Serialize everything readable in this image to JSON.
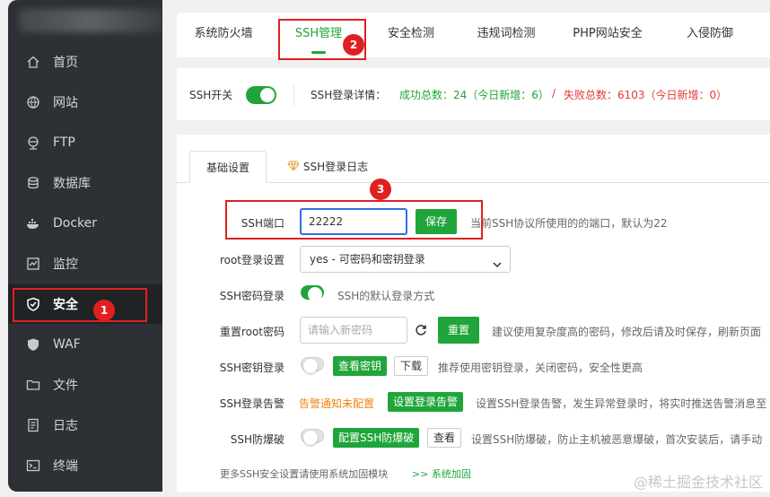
{
  "sidebar": {
    "items": [
      {
        "label": "首页",
        "icon": "home-icon"
      },
      {
        "label": "网站",
        "icon": "globe-icon"
      },
      {
        "label": "FTP",
        "icon": "ftp-icon"
      },
      {
        "label": "数据库",
        "icon": "database-icon"
      },
      {
        "label": "Docker",
        "icon": "docker-icon"
      },
      {
        "label": "监控",
        "icon": "monitor-icon"
      },
      {
        "label": "安全",
        "icon": "shield-check-icon",
        "active": true
      },
      {
        "label": "WAF",
        "icon": "waf-shield-icon"
      },
      {
        "label": "文件",
        "icon": "folder-icon"
      },
      {
        "label": "日志",
        "icon": "log-icon"
      },
      {
        "label": "终端",
        "icon": "terminal-icon"
      }
    ]
  },
  "tabs": [
    {
      "label": "系统防火墙"
    },
    {
      "label": "SSH管理",
      "active": true
    },
    {
      "label": "安全检测"
    },
    {
      "label": "违规词检测"
    },
    {
      "label": "PHP网站安全"
    },
    {
      "label": "入侵防御"
    }
  ],
  "status": {
    "ssh_switch_label": "SSH开关",
    "ssh_switch_on": true,
    "login_detail_label": "SSH登录详情：",
    "success_text": "成功总数：24（今日新增：6）",
    "separator": "/",
    "fail_text": "失败总数：6103（今日新增：0）"
  },
  "subtabs": [
    {
      "label": "基础设置",
      "active": true
    },
    {
      "label": "SSH登录日志",
      "icon": "diamond-icon"
    }
  ],
  "form": {
    "port": {
      "label": "SSH端口",
      "value": "22222",
      "save": "保存",
      "hint": "当前SSH协议所使用的的端口，默认为22"
    },
    "root_login": {
      "label": "root登录设置",
      "selected": "yes - 可密码和密钥登录"
    },
    "password_login": {
      "label": "SSH密码登录",
      "on": true,
      "hint": "SSH的默认登录方式"
    },
    "reset_root": {
      "label": "重置root密码",
      "placeholder": "请输入新密码",
      "button": "重置",
      "hint": "建议使用复杂度高的密码，修改后请及时保存，刷新页面"
    },
    "key_login": {
      "label": "SSH密钥登录",
      "on": false,
      "view": "查看密钥",
      "download": "下载",
      "hint": "推荐使用密钥登录，关闭密码，安全性更高"
    },
    "alert": {
      "label": "SSH登录告警",
      "status": "告警通知未配置",
      "button": "设置登录告警",
      "hint": "设置SSH登录告警，发生异常登录时，将实时推送告警消息至"
    },
    "brute": {
      "label": "SSH防爆破",
      "on": false,
      "button": "配置SSH防爆破",
      "view": "查看",
      "hint": "设置SSH防爆破，防止主机被恶意爆破，首次安装后，请手动"
    },
    "more_text": "更多SSH安全设置请使用系统加固模块",
    "more_link": ">> 系统加固"
  },
  "annotations": {
    "b1": "1",
    "b2": "2",
    "b3": "3",
    "color": "#e02020"
  },
  "watermark": "@稀土掘金技术社区",
  "colors": {
    "accent": "#20a53a",
    "danger": "#e53935",
    "warning": "#f0830e",
    "sidebar": "#2d3035"
  }
}
